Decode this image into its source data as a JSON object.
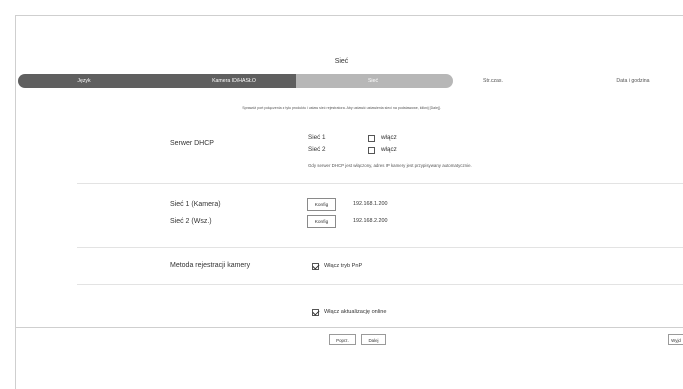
{
  "page_title": "Sieć",
  "steps": [
    {
      "label": "Język",
      "state": "done"
    },
    {
      "label": "Kamera ID/HASŁO",
      "state": "done"
    },
    {
      "label": "Sieć",
      "state": "active"
    },
    {
      "label": "Str.czas.",
      "state": "todo"
    },
    {
      "label": "Data i godzina",
      "state": "todo"
    }
  ],
  "instruction": "Sprawdź port połączenia z tyłu produktu i ustaw sieć rejestratora. Aby ustawić ustawienia sieci na podstawowe, kliknij [Dalej].",
  "dhcp": {
    "label": "Serwer DHCP",
    "net1": "Sieć 1",
    "net2": "Sieć 2",
    "enable_label": "włącz",
    "note": "Gdy serwer DHCP jest włączony, adres IP kamery jest przypisywany automatycznie."
  },
  "networks": [
    {
      "label": "Sieć 1 (Kamera)",
      "button": "Konfig",
      "ip": "192.168.1.200"
    },
    {
      "label": "Sieć 2 (Wsz.)",
      "button": "Konfig",
      "ip": "192.168.2.200"
    }
  ],
  "registration": {
    "label": "Metoda rejestracji kamery",
    "pnp_label": "Włącz tryb PnP"
  },
  "online_update_label": "Włącz aktualizację online",
  "buttons": {
    "prev": "Poprz.",
    "next": "Dalej",
    "exit": "Wyjd"
  }
}
